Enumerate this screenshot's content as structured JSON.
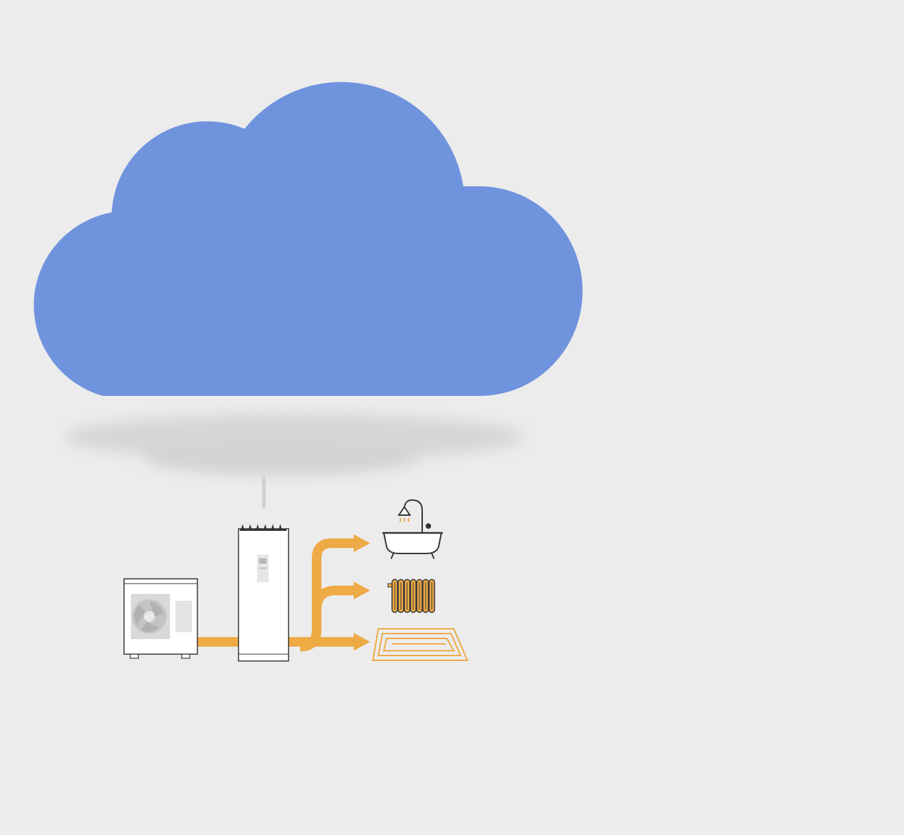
{
  "colors": {
    "background": "#ececec",
    "cloud": "#7093de",
    "cloud_shadow": "#d8d8d8",
    "connector": "#d0d0d0",
    "heat_flow": "#eeaa44",
    "appliance_outline": "#333333",
    "appliance_fill": "#ffffff",
    "fan_grey": "#c9c9c9"
  },
  "diagram": {
    "nodes": [
      {
        "id": "cloud",
        "icon": "cloud-icon"
      },
      {
        "id": "outdoor-unit",
        "icon": "heat-pump-outdoor-unit-icon"
      },
      {
        "id": "indoor-unit",
        "icon": "indoor-hydro-unit-icon"
      },
      {
        "id": "hot-water",
        "icon": "bathtub-shower-icon"
      },
      {
        "id": "radiator",
        "icon": "radiator-icon"
      },
      {
        "id": "underfloor-heating",
        "icon": "underfloor-heating-icon"
      }
    ],
    "edges": [
      {
        "from": "cloud",
        "to": "indoor-unit",
        "style": "line"
      },
      {
        "from": "outdoor-unit",
        "to": "indoor-unit",
        "style": "heat-flow"
      },
      {
        "from": "indoor-unit",
        "to": "hot-water",
        "style": "heat-flow-arrow"
      },
      {
        "from": "indoor-unit",
        "to": "radiator",
        "style": "heat-flow-arrow"
      },
      {
        "from": "indoor-unit",
        "to": "underfloor-heating",
        "style": "heat-flow-arrow"
      }
    ]
  }
}
